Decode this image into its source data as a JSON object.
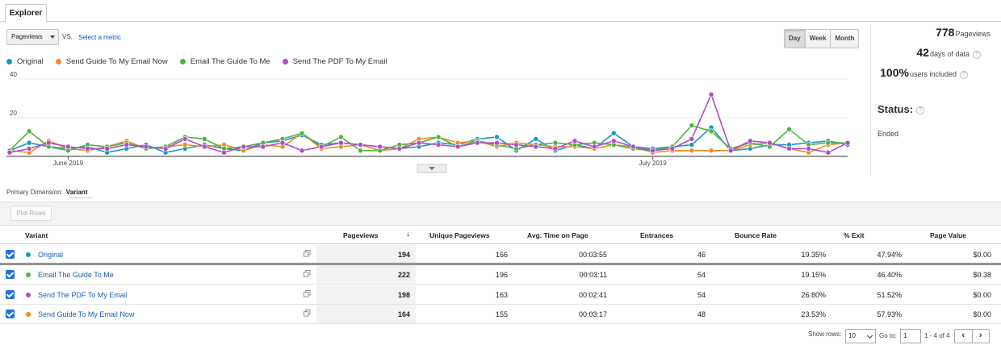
{
  "tab": {
    "label": "Explorer"
  },
  "controls": {
    "metric": "Pageviews",
    "vs": "VS.",
    "select_metric": "Select a metric"
  },
  "periods": [
    "Day",
    "Week",
    "Month"
  ],
  "legend": [
    {
      "name": "Original",
      "color": "#1896c6"
    },
    {
      "name": "Send Guide To My Email Now",
      "color": "#f08a24"
    },
    {
      "name": "Email The Guide To Me",
      "color": "#4fb340"
    },
    {
      "name": "Send The PDF To My Email",
      "color": "#b14bc8"
    }
  ],
  "stats": {
    "pageviews_value": "778",
    "pageviews_label": "Pageviews",
    "days_value": "42",
    "days_label": "days of data",
    "users_value": "100%",
    "users_label": "users included",
    "status_label": "Status:",
    "status_value": "Ended"
  },
  "primary_dimension": {
    "label": "Primary Dimension:",
    "value": "Variant"
  },
  "toolbar": {
    "plot_rows": "Plot Rows"
  },
  "table": {
    "headers": {
      "variant": "Variant",
      "pageviews": "Pageviews",
      "sort_arrow": "↓",
      "unique": "Unique Pageviews",
      "avg_time": "Avg. Time on Page",
      "entrances": "Entrances",
      "bounce": "Bounce Rate",
      "exit": "% Exit",
      "value": "Page Value"
    },
    "rows": [
      {
        "name": "Original",
        "color": "#1896c6",
        "pageviews": "194",
        "unique": "166",
        "avg_time": "00:03:55",
        "entrances": "46",
        "bounce": "19.35%",
        "exit": "47.94%",
        "value": "$0.00"
      },
      {
        "name": "Email The Guide To Me",
        "color": "#4fb340",
        "pageviews": "222",
        "unique": "196",
        "avg_time": "00:03:11",
        "entrances": "54",
        "bounce": "19.15%",
        "exit": "46.40%",
        "value": "$0.38"
      },
      {
        "name": "Send The PDF To My Email",
        "color": "#b14bc8",
        "pageviews": "198",
        "unique": "163",
        "avg_time": "00:02:41",
        "entrances": "54",
        "bounce": "26.80%",
        "exit": "51.52%",
        "value": "$0.00"
      },
      {
        "name": "Send Guide To My Email Now",
        "color": "#f08a24",
        "pageviews": "164",
        "unique": "155",
        "avg_time": "00:03:17",
        "entrances": "48",
        "bounce": "23.53%",
        "exit": "57.93%",
        "value": "$0.00"
      }
    ]
  },
  "pagination": {
    "show_rows_label": "Show rows:",
    "show_rows_value": "10",
    "goto_label": "Go to:",
    "goto_value": "1",
    "range": "1 - 4 of 4",
    "prev": "‹",
    "next": "›"
  },
  "chart_data": {
    "type": "line",
    "ylim": [
      0,
      40
    ],
    "yticks": [
      40,
      20
    ],
    "xlabels": [
      {
        "label": "June 2019",
        "index": 3
      },
      {
        "label": "July 2019",
        "index": 33
      }
    ],
    "series": [
      {
        "name": "Original",
        "color": "#1896c6",
        "values": [
          3,
          7,
          5,
          4,
          5,
          2,
          4,
          6,
          2,
          4,
          6,
          4,
          3,
          7,
          8,
          11,
          6,
          7,
          6,
          5,
          4,
          5,
          7,
          6,
          9,
          10,
          3,
          9,
          3,
          6,
          4,
          12,
          5,
          4,
          5,
          6,
          15,
          3,
          4,
          6,
          6,
          7,
          8,
          6
        ]
      },
      {
        "name": "Send Guide To My Email Now",
        "color": "#f08a24",
        "values": [
          3,
          2,
          8,
          4,
          3,
          5,
          8,
          4,
          5,
          6,
          5,
          6,
          3,
          6,
          5,
          12,
          4,
          5,
          6,
          3,
          4,
          9,
          10,
          7,
          8,
          5,
          7,
          6,
          5,
          5,
          4,
          6,
          5,
          2,
          3,
          3,
          3,
          3,
          6,
          7,
          4,
          2,
          6,
          7
        ]
      },
      {
        "name": "Email The Guide To Me",
        "color": "#4fb340",
        "values": [
          3,
          13,
          5,
          3,
          6,
          5,
          7,
          4,
          5,
          10,
          9,
          4,
          5,
          7,
          9,
          12,
          5,
          10,
          3,
          3,
          6,
          7,
          10,
          5,
          8,
          6,
          4,
          6,
          7,
          6,
          7,
          6,
          4,
          3,
          5,
          16,
          13,
          4,
          7,
          5,
          14,
          6,
          7,
          7
        ]
      },
      {
        "name": "Send The PDF To My Email",
        "color": "#b14bc8",
        "values": [
          2,
          4,
          7,
          5,
          4,
          4,
          6,
          5,
          4,
          9,
          5,
          2,
          5,
          5,
          7,
          3,
          5,
          7,
          6,
          5,
          4,
          7,
          6,
          5,
          7,
          7,
          6,
          5,
          4,
          8,
          5,
          8,
          5,
          3,
          4,
          9,
          32,
          3,
          8,
          7,
          4,
          4,
          2,
          7
        ]
      }
    ]
  }
}
